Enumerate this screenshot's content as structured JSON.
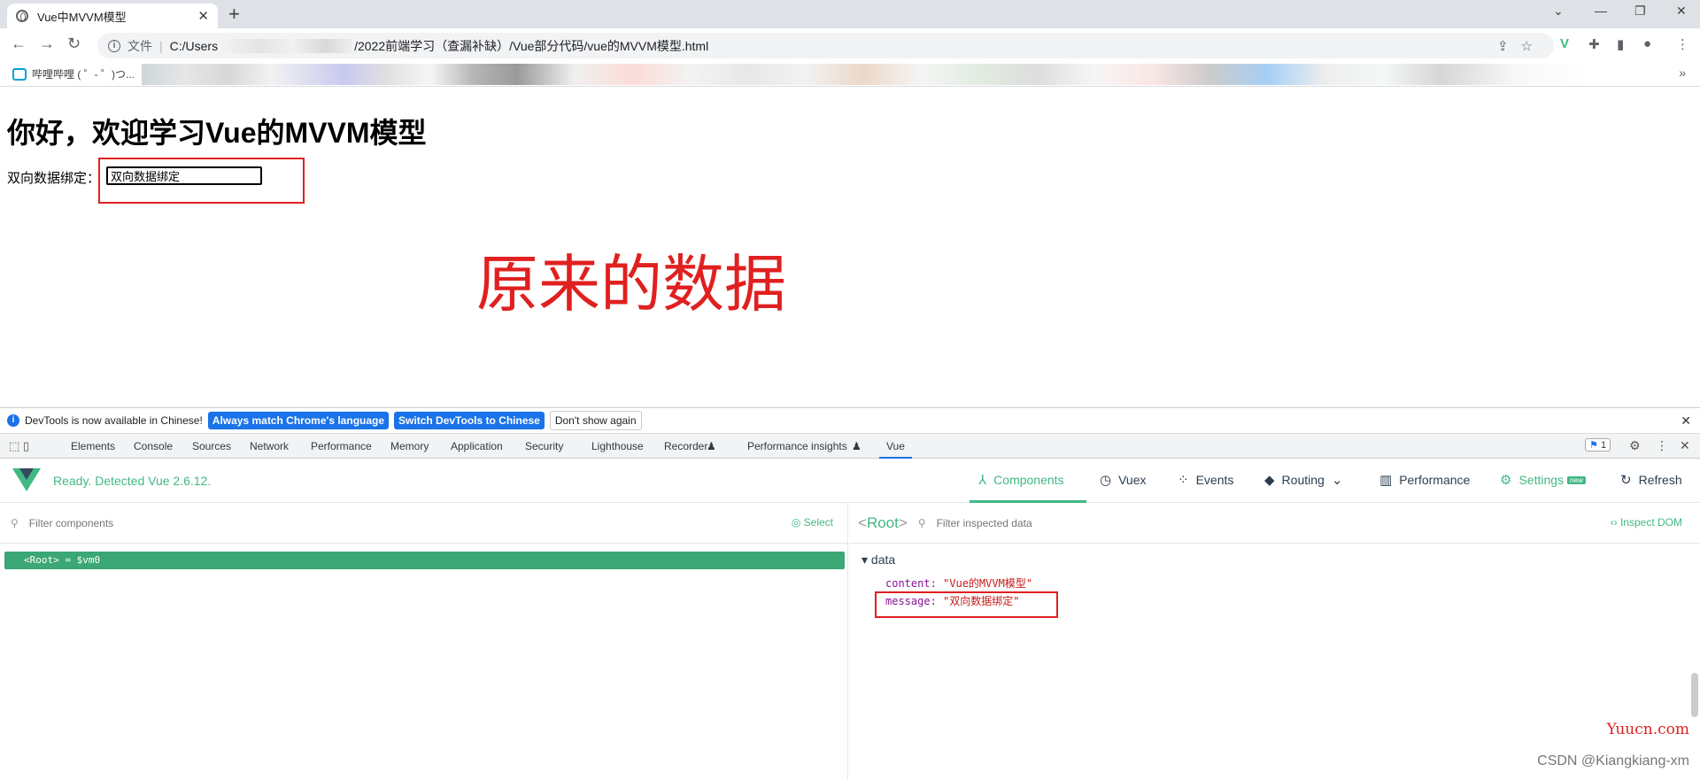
{
  "browser": {
    "tab_title": "Vue中MVVM模型",
    "tab_close": "✕",
    "new_tab": "+",
    "address_file_label": "文件",
    "address_prefix": "C:/Users",
    "address_suffix": "/2022前端学习（查漏补缺）/Vue部分代码/vue的MVVM模型.html",
    "bookmark_label": "哔哩哔哩 ( ゜- ゜)つ...",
    "bookmarks_more": "»"
  },
  "page": {
    "heading": "你好，欢迎学习Vue的MVVM模型",
    "field_label": "双向数据绑定：",
    "field_value": "双向数据绑定",
    "annotation": "原来的数据"
  },
  "devtools": {
    "infobar": {
      "message": "DevTools is now available in Chinese!",
      "btn_match": "Always match Chrome's language",
      "btn_switch": "Switch DevTools to Chinese",
      "btn_dismiss": "Don't show again"
    },
    "tabs": [
      "Elements",
      "Console",
      "Sources",
      "Network",
      "Performance",
      "Memory",
      "Application",
      "Security",
      "Lighthouse",
      "Recorder",
      "Performance insights",
      "Vue"
    ],
    "issues_count": "1"
  },
  "vue": {
    "status": "Ready. Detected Vue 2.6.12.",
    "nav": {
      "components": "Components",
      "vuex": "Vuex",
      "events": "Events",
      "routing": "Routing",
      "performance": "Performance",
      "settings": "Settings",
      "settings_badge": "new",
      "refresh": "Refresh"
    },
    "filter_components_placeholder": "Filter components",
    "select_label": "Select",
    "root_row": "<Root> = $vm0",
    "root_label": "Root",
    "filter_data_placeholder": "Filter inspected data",
    "inspect_dom": "Inspect DOM",
    "data_section": "data",
    "data": [
      {
        "key": "content",
        "value": "\"Vue的MVVM模型\""
      },
      {
        "key": "message",
        "value": "\"双向数据绑定\""
      }
    ]
  },
  "watermarks": {
    "site": "Yuucn.com",
    "author": "CSDN @Kiangkiang-xm"
  },
  "colors": {
    "vue_green": "#42b883",
    "annotation_red": "#e02020",
    "chrome_blue": "#1a73e8"
  }
}
